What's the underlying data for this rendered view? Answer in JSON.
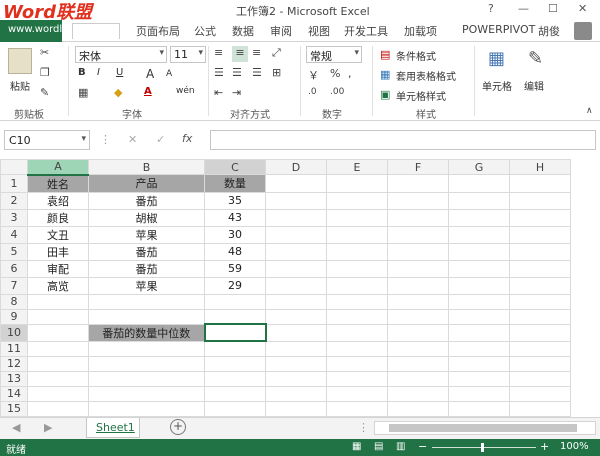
{
  "title_bar": {
    "app_title": "工作簿2 - Microsoft Excel",
    "watermark": "Word联盟",
    "watermark_url": "www.wordlm.com",
    "help": "?",
    "min": "—",
    "max": "☐",
    "close": "✕"
  },
  "tabs": [
    "页面布局",
    "公式",
    "数据",
    "审阅",
    "视图",
    "开发工具",
    "加载项",
    "POWERPIVOT"
  ],
  "user": "胡俊",
  "ribbon": {
    "paste": "粘贴",
    "clipboard": "剪贴板",
    "font_name": "宋体",
    "font_size": "11",
    "font_group": "字体",
    "align_group": "对齐方式",
    "number_format": "常规",
    "number_group": "数字",
    "cond_format": "条件格式",
    "table_format": "套用表格格式",
    "cell_style": "单元格样式",
    "style_group": "样式",
    "cells": "单元格",
    "editing": "编辑",
    "bold": "B",
    "italic": "I",
    "underline": "U",
    "grow": "A",
    "shrink": "A",
    "fill_color": "A",
    "wen": "wén"
  },
  "formula_bar": {
    "name_box": "C10",
    "fx": "fx",
    "cancel": "✕",
    "enter": "✓",
    "value": ""
  },
  "columns": [
    "A",
    "B",
    "C",
    "D",
    "E",
    "F",
    "G",
    "H"
  ],
  "rows": [
    [
      "姓名",
      "产品",
      "数量"
    ],
    [
      "袁绍",
      "番茄",
      "35"
    ],
    [
      "颜良",
      "胡椒",
      "43"
    ],
    [
      "文丑",
      "苹果",
      "30"
    ],
    [
      "田丰",
      "番茄",
      "48"
    ],
    [
      "审配",
      "番茄",
      "59"
    ],
    [
      "高览",
      "苹果",
      "29"
    ]
  ],
  "row_numbers": [
    "1",
    "2",
    "3",
    "4",
    "5",
    "6",
    "7",
    "8",
    "9",
    "10",
    "11",
    "12",
    "13",
    "14",
    "15",
    "16"
  ],
  "label_row10": "番茄的数量中位数",
  "sheet_tab": "Sheet1",
  "status": {
    "ready": "就绪",
    "zoom": "100%",
    "minus": "−",
    "plus": "+"
  },
  "colors": {
    "accent": "#217346",
    "header_fill": "#a6a6a6",
    "active_col": "#9fd5b7"
  }
}
